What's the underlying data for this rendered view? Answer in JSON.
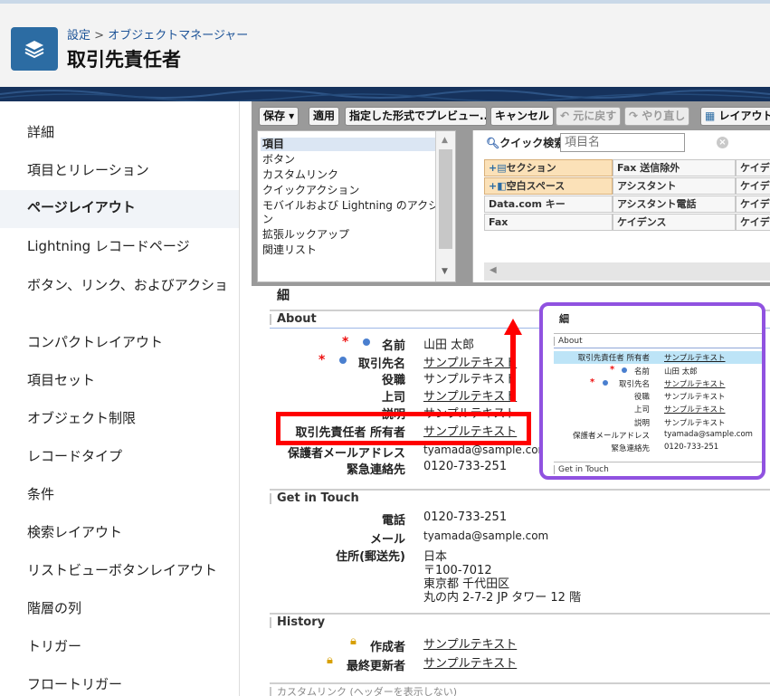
{
  "header": {
    "breadcrumb_root": "設定",
    "breadcrumb_sep": ">",
    "breadcrumb_parent": "オブジェクトマネージャー",
    "title": "取引先責任者",
    "icon": "layers-icon"
  },
  "sidebar": {
    "items": [
      {
        "label": "詳細"
      },
      {
        "label": "項目とリレーション"
      },
      {
        "label": "ページレイアウト",
        "active": true
      },
      {
        "label": "Lightning レコードページ"
      },
      {
        "label": "ボタン、リンク、およびアクション"
      },
      {
        "label": "コンパクトレイアウト"
      },
      {
        "label": "項目セット"
      },
      {
        "label": "オブジェクト制限"
      },
      {
        "label": "レコードタイプ"
      },
      {
        "label": "条件"
      },
      {
        "label": "検索レイアウト"
      },
      {
        "label": "リストビューボタンレイアウト"
      },
      {
        "label": "階層の列"
      },
      {
        "label": "トリガー"
      },
      {
        "label": "フロートリガー"
      }
    ],
    "item_line2": "ョン"
  },
  "toolbar": {
    "save": "保存 ▾",
    "quick_save": "適用",
    "preview": "指定した形式でプレビュー...▾",
    "cancel": "キャンセル",
    "undo": "元に戻す",
    "redo": "やり直し",
    "layout": "レイアウトの"
  },
  "palette_list": {
    "items": [
      "項目",
      "ボタン",
      "カスタムリンク",
      "クイックアクション",
      "モバイルおよび Lightning のアクショ",
      "ン",
      "拡張ルックアップ",
      "関連リスト"
    ],
    "selected": "項目"
  },
  "quick_search": {
    "label": "クイック検索",
    "placeholder": "項目名"
  },
  "palette_grid": {
    "rows": [
      [
        "セクション",
        "Fax 送信除外",
        "ケイデン"
      ],
      [
        "空白スペース",
        "アシスタント",
        "ケイデン"
      ],
      [
        "Data.com キー",
        "アシスタント電話",
        "ケイデン"
      ],
      [
        "Fax",
        "ケイデンス",
        "ケイデン"
      ]
    ]
  },
  "layout": {
    "detail_title": "細",
    "about": {
      "title": "About",
      "fields": [
        {
          "label": "名前",
          "value": "山田 太郎",
          "link": false
        },
        {
          "label": "取引先名",
          "value": "サンプルテキスト",
          "link": true
        },
        {
          "label": "役職",
          "value": "サンプルテキスト",
          "link": false
        },
        {
          "label": "上司",
          "value": "サンプルテキスト",
          "link": true
        },
        {
          "label": "説明",
          "value": "サンプルテキスト",
          "link": false
        },
        {
          "label": "取引先責任者 所有者",
          "value": "サンプルテキスト",
          "link": true
        },
        {
          "label": "保護者メールアドレス",
          "value": "tyamada@sample.com",
          "link": false
        },
        {
          "label": "緊急連絡先",
          "value": "0120-733-251",
          "link": false
        }
      ]
    },
    "get_in_touch": {
      "title": "Get in Touch",
      "phone_label": "電話",
      "phone": "0120-733-251",
      "email_label": "メール",
      "email": "tyamada@sample.com",
      "address_label": "住所(郵送先)",
      "address": [
        "日本",
        "〒100-7012",
        "東京都 千代田区",
        "丸の内 2-7-2 JP タワー 12 階"
      ]
    },
    "history": {
      "title": "History",
      "created_by_label": "作成者",
      "created_by": "サンプルテキスト",
      "modified_by_label": "最終更新者",
      "modified_by": "サンプルテキスト"
    },
    "custom_links_title": "カスタムリンク (ヘッダーを表示しない)"
  },
  "preview": {
    "title": "細",
    "about": "About",
    "fields": [
      {
        "label": "取引先責任者 所有者",
        "value": "サンプルテキスト",
        "link": true
      },
      {
        "label": "名前",
        "value": "山田 太郎",
        "link": false
      },
      {
        "label": "取引先名",
        "value": "サンプルテキスト",
        "link": true
      },
      {
        "label": "役職",
        "value": "サンプルテキスト",
        "link": false
      },
      {
        "label": "上司",
        "value": "サンプルテキスト",
        "link": true
      },
      {
        "label": "説明",
        "value": "サンプルテキスト",
        "link": false
      },
      {
        "label": "保護者メールアドレス",
        "value": "tyamada@sample.com",
        "link": false
      },
      {
        "label": "緊急連絡先",
        "value": "0120-733-251",
        "link": false
      }
    ],
    "get_in_touch": "Get in Touch"
  },
  "annotation_colors": {
    "highlight_box": "#ff0000",
    "arrow": "#ff0000",
    "preview_border": "#9052e0"
  }
}
